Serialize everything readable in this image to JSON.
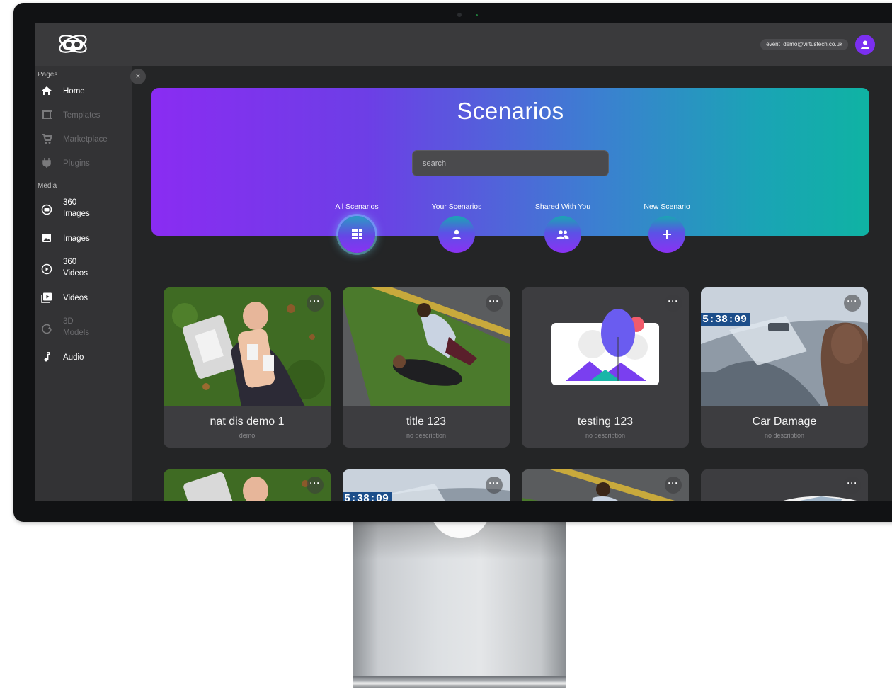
{
  "app": {
    "logo_icon": "vr-headset-logo-icon",
    "user_email": "event_demo@virtustech.co.uk",
    "avatar_icon": "user-icon",
    "accent_color": "#7b2ff0"
  },
  "sidebar": {
    "sections": [
      {
        "label": "Pages",
        "items": [
          {
            "label": "Home",
            "icon": "home-icon",
            "enabled": true
          },
          {
            "label": "Templates",
            "icon": "templates-icon",
            "enabled": false
          },
          {
            "label": "Marketplace",
            "icon": "cart-icon",
            "enabled": false
          },
          {
            "label": "Plugins",
            "icon": "plug-icon",
            "enabled": false
          }
        ]
      },
      {
        "label": "Media",
        "items": [
          {
            "label": "360\nImages",
            "icon": "360-image-icon",
            "enabled": true
          },
          {
            "label": "Images",
            "icon": "image-icon",
            "enabled": true
          },
          {
            "label": "360\nVideos",
            "icon": "360-video-icon",
            "enabled": true
          },
          {
            "label": "Videos",
            "icon": "video-library-icon",
            "enabled": true
          },
          {
            "label": "3D\nModels",
            "icon": "3d-model-icon",
            "enabled": false
          },
          {
            "label": "Audio",
            "icon": "music-note-icon",
            "enabled": true
          }
        ]
      }
    ],
    "close_label": "×"
  },
  "hero": {
    "title": "Scenarios",
    "search_placeholder": "search",
    "search_value": "",
    "tabs": [
      {
        "label": "All Scenarios",
        "icon": "grid-icon",
        "active": true
      },
      {
        "label": "Your Scenarios",
        "icon": "person-icon",
        "active": false
      },
      {
        "label": "Shared With You",
        "icon": "group-icon",
        "active": false
      },
      {
        "label": "New Scenario",
        "icon": "plus-icon",
        "active": false
      }
    ]
  },
  "cards": [
    {
      "title": "nat dis demo 1",
      "description": "demo",
      "thumbnail": "cpr-manikin-photo"
    },
    {
      "title": "title 123",
      "description": "no description",
      "thumbnail": "roadside-first-aid-photo"
    },
    {
      "title": "testing 123",
      "description": "no description",
      "thumbnail": "placeholder-illustration"
    },
    {
      "title": "Car Damage",
      "description": "no description",
      "thumbnail": "car-interior-360-photo",
      "overlay_text": "5:38:09"
    },
    {
      "title": "",
      "description": "",
      "thumbnail": "cpr-manikin-photo"
    },
    {
      "title": "",
      "description": "",
      "thumbnail": "car-interior-360-photo",
      "overlay_text": "5:38:09"
    },
    {
      "title": "",
      "description": "",
      "thumbnail": "roadside-first-aid-photo"
    },
    {
      "title": "",
      "description": "",
      "thumbnail": "white-car-photo"
    }
  ],
  "more_button_label": "···"
}
